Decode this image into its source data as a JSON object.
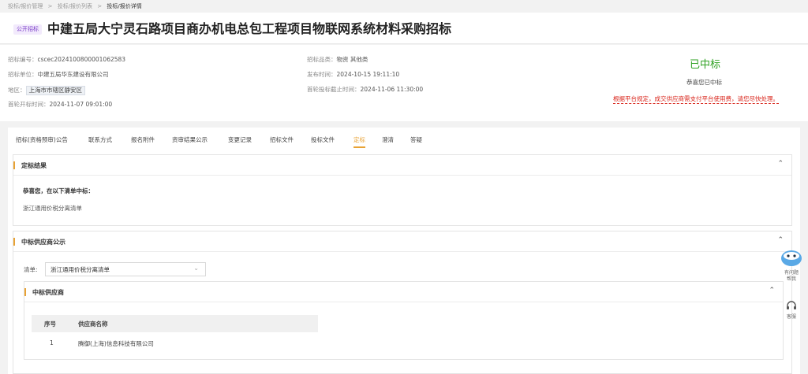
{
  "breadcrumb": [
    "投标/报价管理",
    ">",
    "投标/报价列表",
    ">",
    "投标/报价详情"
  ],
  "tag": "公开招标",
  "title": "中建五局大宁灵石路项目商办机电总包工程项目物联网系统材料采购招标",
  "info": {
    "code_k": "招标编号：",
    "code": "cscec2024100800001062583",
    "unit_k": "招标单位：",
    "unit": "中建五局华东建设有限公司",
    "area_k": "地区：",
    "area": "上海市市辖区静安区",
    "open_k": "首轮开标时间：",
    "open": "2024-11-07 09:01:00",
    "cat_k": "招标品类：",
    "cat": "物资 其他类",
    "pub_k": "发布时间：",
    "pub": "2024-10-15 19:11:10",
    "deadline_k": "首轮投标截止时间：",
    "deadline": "2024-11-06 11:30:00"
  },
  "status": {
    "won": "已中标",
    "congrats": "恭喜您已中标",
    "warn": "根据平台规定，成交供应商需支付平台使用费，请您尽快处理。"
  },
  "tabs": [
    "招标(资格预审)公告",
    "联系方式",
    "报名附件",
    "资审结果公示",
    "变更记录",
    "招标文件",
    "投标文件",
    "定标",
    "澄清",
    "答疑"
  ],
  "active_tab": "定标",
  "result_panel": {
    "title": "定标结果",
    "congrats": "恭喜您，在以下清单中标：",
    "item": "浙江通用价税分离清单"
  },
  "supplier_panel": {
    "title": "中标供应商公示",
    "list_label": "清单:",
    "list_value": "浙江通用价税分离清单"
  },
  "inner_panel": {
    "title": "中标供应商",
    "headers": [
      "序号",
      "供应商名称"
    ],
    "rows": [
      [
        "1",
        "腾御(上海)信息科技有限公司"
      ]
    ]
  },
  "side": {
    "ask": "有问题\n帮我",
    "service": "客服"
  },
  "colors": {
    "accent": "#e8a234",
    "won": "#2ea121",
    "warn": "#d9261c",
    "tag": "#7a3cc8"
  }
}
